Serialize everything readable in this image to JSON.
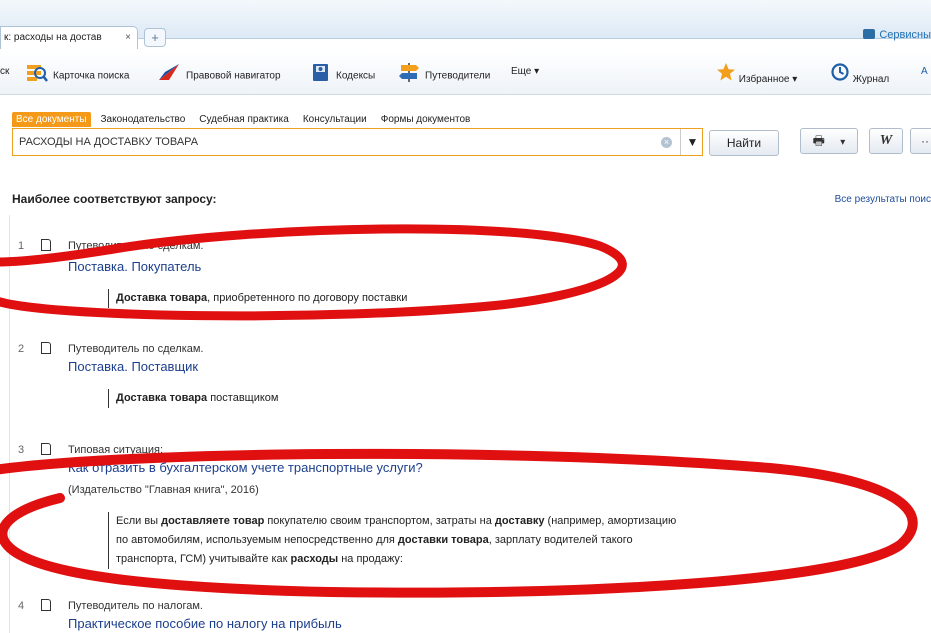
{
  "tabs": {
    "active_tab": "к: расходы на достав",
    "close": "×",
    "add": "+",
    "services": "Сервисны"
  },
  "toolbar": {
    "search_partial": "ск",
    "card": "Карточка поиска",
    "navigator": "Правовой навигатор",
    "codes": "Кодексы",
    "guides": "Путеводители",
    "more": "Еще ▾",
    "favorites": "Избранное ▾",
    "journal": "Журнал",
    "extra": "А"
  },
  "filter_tabs": [
    "Все документы",
    "Законодательство",
    "Судебная практика",
    "Консультации",
    "Формы документов"
  ],
  "search": {
    "value": "РАСХОДЫ НА ДОСТАВКУ ТОВАРА",
    "clear": "×",
    "dropdown": "▼",
    "find": "Найти",
    "print": "🖶",
    "print_dd": "▾",
    "word": "W",
    "more": "··"
  },
  "results": {
    "title": "Наиболее соответствуют запросу:",
    "all": "Все результаты поис",
    "items": [
      {
        "num": "1",
        "category": "Путеводитель по сделкам.",
        "link": "Поставка. Покупатель",
        "snippet_bold": "Доставка товара",
        "snippet_rest": ", приобретенного по договору поставки"
      },
      {
        "num": "2",
        "category": "Путеводитель по сделкам.",
        "link": "Поставка. Поставщик",
        "snippet_bold": "Доставка товара",
        "snippet_rest": " поставщиком"
      },
      {
        "num": "3",
        "category": "Типовая ситуация:",
        "link": "Как отразить в бухгалтерском учете транспортные услуги?",
        "source": "(Издательство \"Главная книга\", 2016)",
        "s1": "Если вы ",
        "s2": "доставляете товар",
        "s3": " покупателю своим транспортом, затраты на ",
        "s4": "доставку",
        "s5": " (например, амортизацию",
        "s6": "по автомобилям, используемым непосредственно для ",
        "s7": "доставки товара",
        "s8": ", зарплату водителей такого",
        "s9": "транспорта, ГСМ) учитывайте как ",
        "s10": "расходы",
        "s11": " на продажу:"
      },
      {
        "num": "4",
        "category": "Путеводитель по налогам.",
        "link": "Практическое пособие по налогу на прибыль"
      }
    ]
  },
  "colors": {
    "accent_orange": "#f59a18",
    "link_blue": "#1c3f8c",
    "highlight_red": "#e01010"
  }
}
